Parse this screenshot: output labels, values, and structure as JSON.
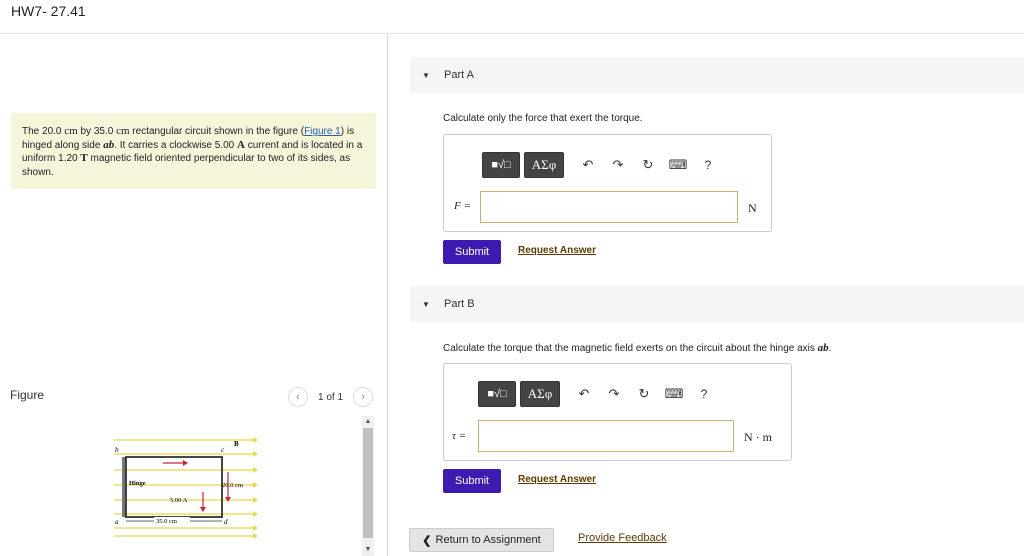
{
  "header": {
    "title": "HW7- 27.41"
  },
  "problem": {
    "text_1": "The 20.0 ",
    "unit_cm_1": "cm",
    "text_2": " by 35.0 ",
    "unit_cm_2": "cm",
    "text_3": " rectangular circuit shown in the figure (",
    "figure_link": "Figure 1",
    "text_4": ") is hinged along side ",
    "side_ab": "ab",
    "text_5": ". It carries a clockwise 5.00 ",
    "unit_A": "A",
    "text_6": " current and is located in a uniform 1.20 ",
    "unit_T": "T",
    "text_7": " magnetic field oriented perpendicular to two of its sides, as shown."
  },
  "figure_panel": {
    "label": "Figure",
    "pager_text": "1 of 1",
    "prev_icon": "chevron-left-icon",
    "next_icon": "chevron-right-icon",
    "diagram": {
      "corner_b": "b",
      "corner_c": "c",
      "corner_a": "a",
      "corner_d": "d",
      "field_label": "B",
      "hinge_label": "Hinge",
      "height_label": "20.0 cm",
      "current_label": "5.00 A",
      "width_label": "35.0 cm"
    }
  },
  "part_a": {
    "label": "Part A",
    "toggle_icon": "triangle-down-icon",
    "question": "Calculate only the force that exert the torque.",
    "toolbar": {
      "matrix_label": "■√□",
      "greek_label": "ΑΣφ",
      "undo_icon": "undo-icon",
      "redo_icon": "redo-icon",
      "reset_icon": "reset-icon",
      "keyboard_icon": "keyboard-icon",
      "help_label": "?"
    },
    "variable": "F =",
    "input_value": "",
    "unit": "N",
    "submit_label": "Submit",
    "request_label": "Request Answer"
  },
  "part_b": {
    "label": "Part B",
    "toggle_icon": "triangle-down-icon",
    "question_1": "Calculate the torque that the magnetic field exerts on the circuit about the hinge axis ",
    "question_ab": "ab",
    "question_2": ".",
    "toolbar": {
      "matrix_label": "■√□",
      "greek_label": "ΑΣφ",
      "undo_icon": "undo-icon",
      "redo_icon": "redo-icon",
      "reset_icon": "reset-icon",
      "keyboard_icon": "keyboard-icon",
      "help_label": "?"
    },
    "variable": "τ =",
    "input_value": "",
    "unit": "N · m",
    "submit_label": "Submit",
    "request_label": "Request Answer"
  },
  "footer": {
    "return_label": "Return to Assignment",
    "return_icon": "chevron-left-icon",
    "feedback_label": "Provide Feedback"
  }
}
